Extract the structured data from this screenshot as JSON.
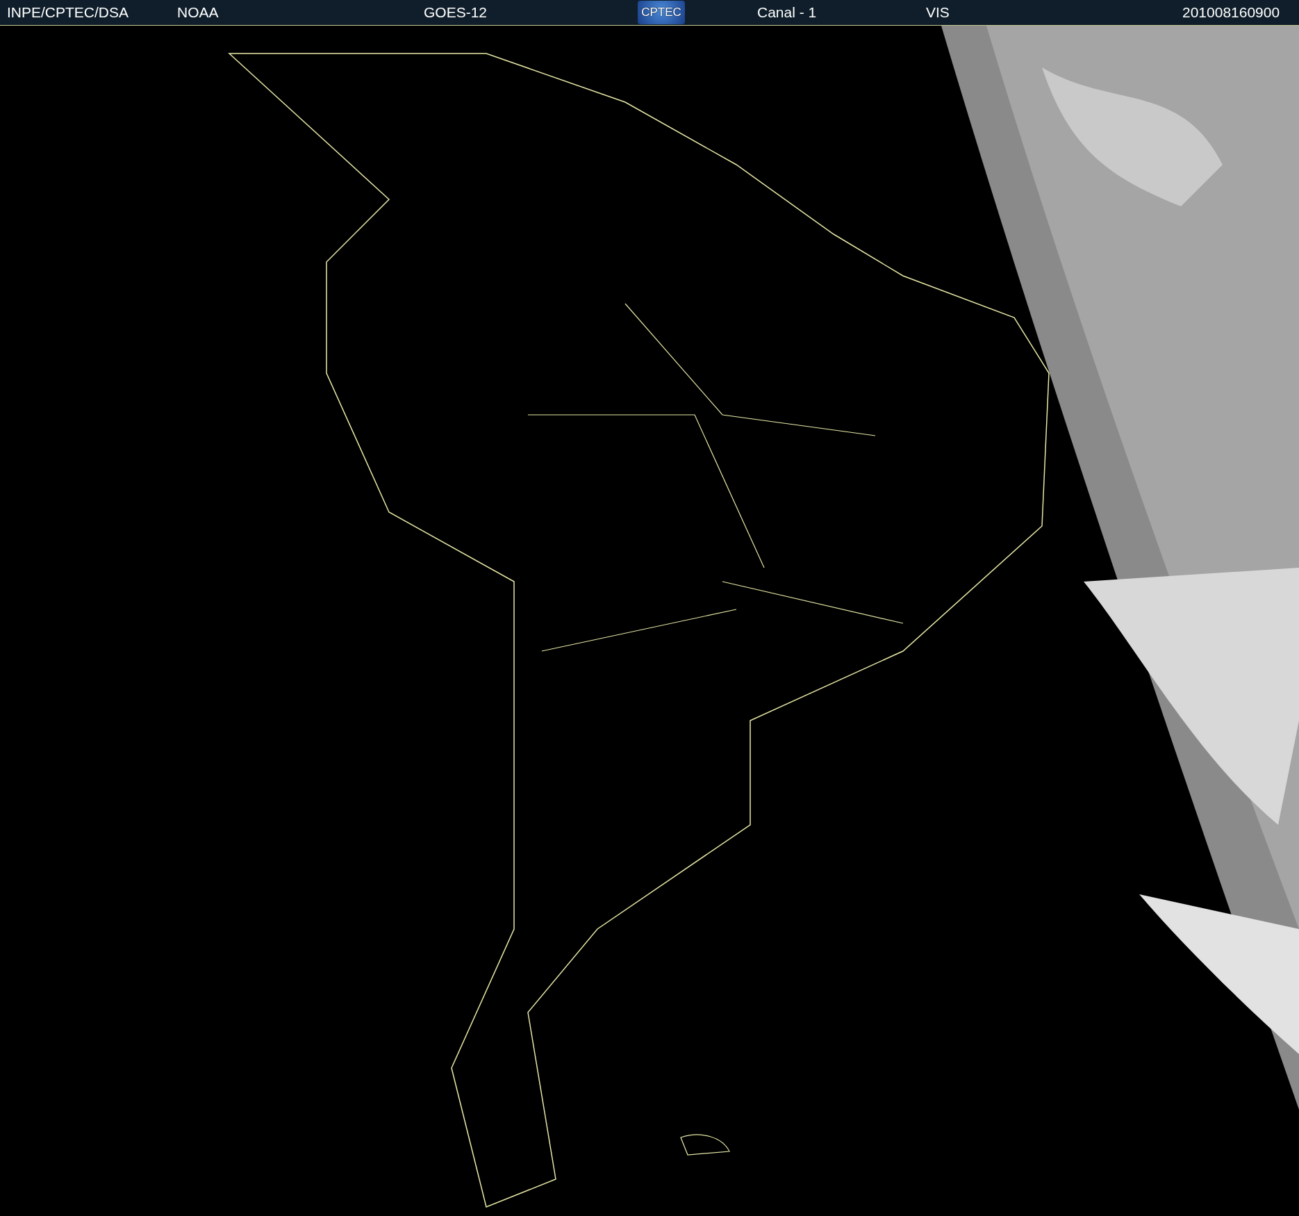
{
  "header": {
    "source": "INPE/CPTEC/DSA",
    "agency": "NOAA",
    "satellite": "GOES-12",
    "logo": "CPTEC",
    "channel": "Canal - 1",
    "band": "VIS",
    "timestamp": "201008160900"
  }
}
